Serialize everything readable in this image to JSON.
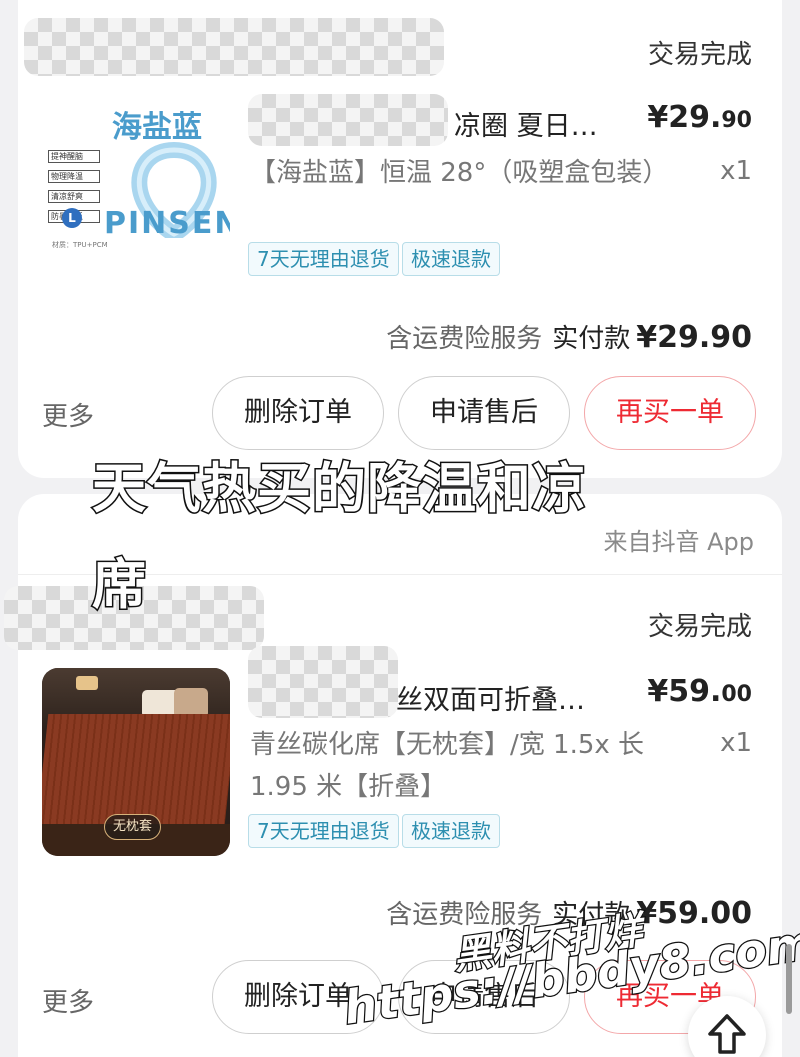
{
  "orders": [
    {
      "status": "交易完成",
      "product": {
        "title": "凉圈 夏日…",
        "price_int": "¥29.",
        "price_dec": "90",
        "spec": "【海盐蓝】恒温 28°（吸塑盒包装）",
        "qty": "x1",
        "tags": [
          "7天无理由退货",
          "极速退款"
        ],
        "thumb": {
          "brand_title": "海盐蓝",
          "brand_name": "PINSEN",
          "size_badge": "L",
          "features": [
            "提神醒脑",
            "物理降温",
            "清凉舒爽",
            "防暑解乏"
          ],
          "material": "材质：TPU+PCM"
        }
      },
      "summary": {
        "service": "含运费险服务",
        "paid_label": "实付款",
        "paid_amount": "¥29.90"
      },
      "actions": {
        "more": "更多",
        "delete": "删除订单",
        "after_sale": "申请售后",
        "rebuy": "再买一单"
      }
    },
    {
      "source": "来自抖音 App",
      "status": "交易完成",
      "product": {
        "title": "丝双面可折叠…",
        "price_int": "¥59.",
        "price_dec": "00",
        "spec": "青丝碳化席【无枕套】/宽 1.5x 长 1.95 米【折叠】",
        "qty": "x1",
        "tags": [
          "7天无理由退货",
          "极速退款"
        ],
        "thumb": {
          "badge": "无枕套"
        }
      },
      "summary": {
        "service": "含运费险服务",
        "paid_label": "实付款",
        "paid_amount": "¥59.00"
      },
      "actions": {
        "more": "更多",
        "delete": "删除订单",
        "after_sale": "申请售后",
        "rebuy": "再买一单"
      }
    }
  ],
  "overlay": {
    "line1": "天气热买的降温和凉",
    "line2": "席"
  },
  "watermark": {
    "line1": "黑料不打烊",
    "line2": "https://bbdy8.com"
  },
  "icons": {
    "fab": "arrow-up-icon"
  },
  "colors": {
    "accent_red": "#ee2a33",
    "tag_blue": "#2d8fb0"
  }
}
